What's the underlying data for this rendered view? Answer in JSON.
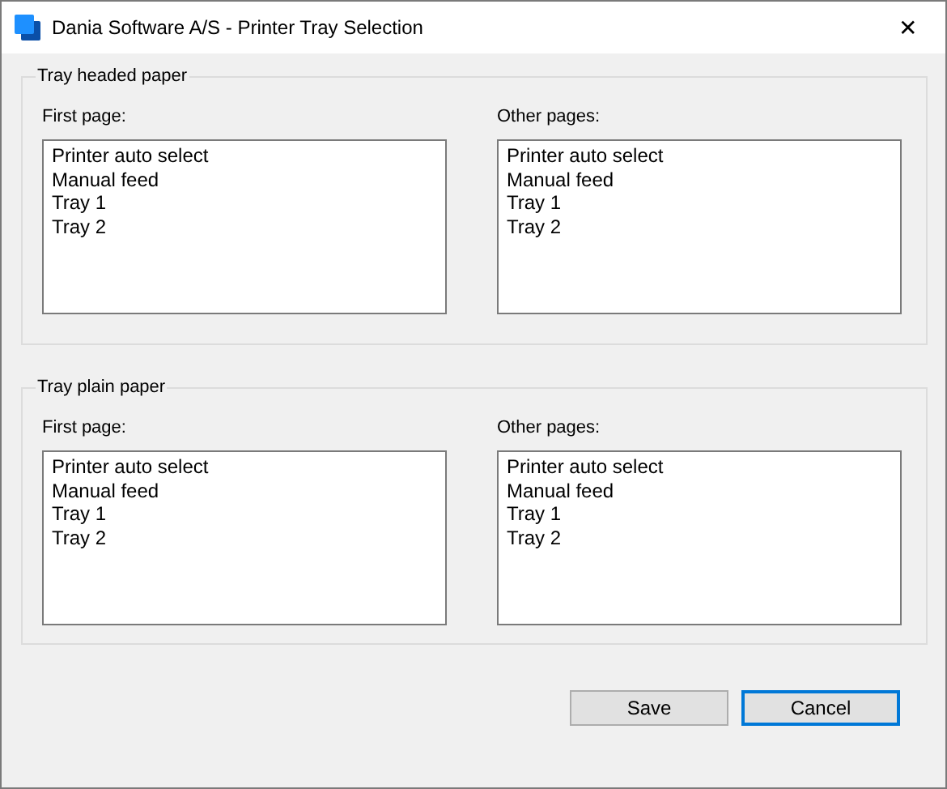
{
  "window": {
    "title": "Dania Software A/S - Printer Tray Selection",
    "close": "✕"
  },
  "groups": [
    {
      "title": "Tray headed paper",
      "lists": [
        {
          "label": "First page:",
          "items": [
            "Printer auto select",
            "Manual feed",
            "Tray 1",
            "Tray 2"
          ]
        },
        {
          "label": "Other pages:",
          "items": [
            "Printer auto select",
            "Manual feed",
            "Tray 1",
            "Tray 2"
          ]
        }
      ]
    },
    {
      "title": "Tray plain paper",
      "lists": [
        {
          "label": "First page:",
          "items": [
            "Printer auto select",
            "Manual feed",
            "Tray 1",
            "Tray 2"
          ]
        },
        {
          "label": "Other pages:",
          "items": [
            "Printer auto select",
            "Manual feed",
            "Tray 1",
            "Tray 2"
          ]
        }
      ]
    }
  ],
  "buttons": [
    {
      "label": "Save",
      "focused": false
    },
    {
      "label": "Cancel",
      "focused": true
    }
  ]
}
